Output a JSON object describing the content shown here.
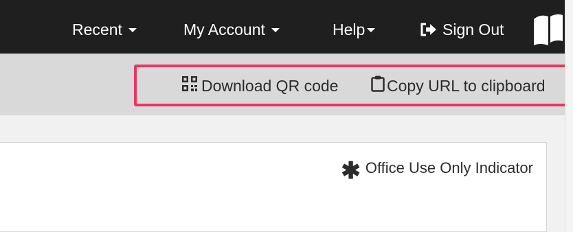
{
  "nav": {
    "recent_label": "Recent",
    "account_label": "My Account",
    "help_label": "Help",
    "signout_label": "Sign Out",
    "signout_icon": "sign-out-icon",
    "logo_icon": "book-logo-icon"
  },
  "toolbar": {
    "download_qr_label": "Download QR code",
    "download_qr_icon": "qr-code-icon",
    "copy_url_label": "Copy URL to clipboard",
    "copy_url_icon": "clipboard-icon",
    "highlight_color": "#ea3562"
  },
  "content": {
    "indicator_symbol": "✱",
    "indicator_label": "Office Use Only Indicator"
  },
  "colors": {
    "navbar_bg": "#1f1f1f",
    "toolbar_bg": "#d9d9d9",
    "text_dark": "#2c2c2c"
  }
}
